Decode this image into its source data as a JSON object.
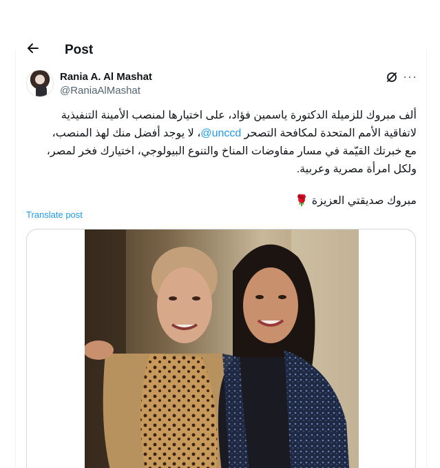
{
  "header": {
    "title": "Post",
    "back_icon": "arrow-left-icon"
  },
  "author": {
    "name": "Rania A. Al Mashat",
    "handle": "@RaniaAlMashat",
    "avatar_icon": "avatar"
  },
  "actions": {
    "grok_icon": "grok-icon",
    "more_icon": "more-horizontal-icon",
    "more_glyph": "···"
  },
  "tweet": {
    "line1": "ألف مبروك للزميلة الدكتورة ياسمين فؤاد، على اختيارها لمنصب الأمينة التنفيذية",
    "line2_pre": "لاتفاقية الأمم المتحدة لمكافحة التصحر ",
    "mention": "@unccd",
    "line2_post": "، لا يوجد أفضل منك لهذ المنصب،",
    "line3": "مع خبرتك القيّمة في مسار مفاوضات المناخ والتنوع البيولوجي، اختيارك فخر لمصر،",
    "line4": "ولكل امرأة مصرية وعربية.",
    "line5": "مبروك صديقتي العزيزة 🌹"
  },
  "translate_label": "Translate post",
  "media": {
    "type": "photo"
  },
  "colors": {
    "link": "#1d9bf0",
    "text": "#0f1419",
    "muted": "#536471",
    "border": "#cfd9de"
  }
}
